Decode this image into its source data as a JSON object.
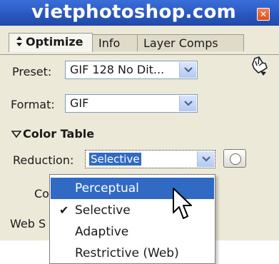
{
  "window": {
    "title": "vietphotoshop.com",
    "close_glyph": "✕"
  },
  "tabs": [
    {
      "label": "Optimize",
      "icon": "arrows-updown-icon",
      "active": true
    },
    {
      "label": "Info",
      "active": false
    },
    {
      "label": "Layer Comps",
      "active": false
    }
  ],
  "panel_menu_icon": "▸",
  "preset": {
    "label": "Preset:",
    "value": "GIF 128 No Dit..."
  },
  "format": {
    "label": "Format:",
    "value": "GIF"
  },
  "color_table": {
    "header": "Color Table",
    "reduction_label": "Reduction:",
    "reduction_value": "Selective",
    "colors_label_partial": "Co",
    "web_snap_label_partial": "Web S"
  },
  "reduction_menu": {
    "items": [
      {
        "label": "Perceptual",
        "highlighted": true,
        "checked": false
      },
      {
        "label": "Selective",
        "highlighted": false,
        "checked": true
      },
      {
        "label": "Adaptive",
        "highlighted": false,
        "checked": false
      },
      {
        "label": "Restrictive (Web)",
        "highlighted": false,
        "checked": false
      }
    ],
    "check_glyph": "✔"
  },
  "colors": {
    "titlebar": "#2a58c0",
    "highlight": "#316ac5",
    "panel_bg": "#ece9d8"
  }
}
